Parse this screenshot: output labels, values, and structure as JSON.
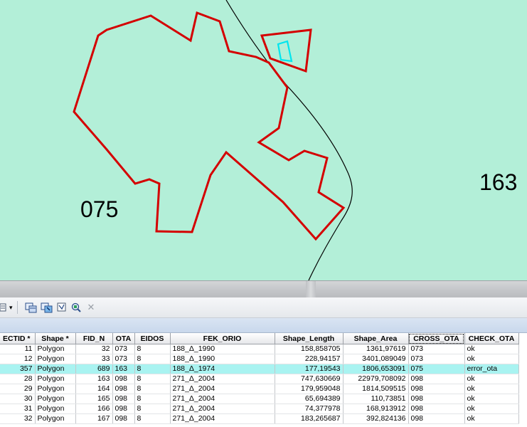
{
  "map": {
    "background_color": "#b3efd8",
    "polygon_outline_color": "#d40000",
    "selection_outline_color": "#00e5ee",
    "boundary_line_color": "#000000",
    "labels": [
      {
        "id": "zone-075",
        "text": "075"
      },
      {
        "id": "zone-163",
        "text": "163"
      }
    ]
  },
  "toolbar": {
    "buttons": [
      {
        "name": "table-options-icon",
        "label": "▾"
      },
      {
        "name": "related-tables-icon",
        "label": ""
      },
      {
        "name": "select-by-attributes-icon",
        "label": ""
      },
      {
        "name": "switch-selection-icon",
        "label": ""
      },
      {
        "name": "zoom-to-selected-icon",
        "label": ""
      },
      {
        "name": "delete-selected-icon",
        "label": "✕"
      }
    ]
  },
  "table": {
    "columns": [
      "ECTID *",
      "Shape *",
      "FID_N",
      "OTA",
      "EIDOS",
      "FEK_ORIO",
      "Shape_Length",
      "Shape_Area",
      "CROSS_OTA",
      "CHECK_OTA"
    ],
    "selected_column": "CROSS_OTA",
    "rows": [
      [
        "11",
        "Polygon",
        "32",
        "073",
        "8",
        "188_Δ_1990",
        "158,858705",
        "1361,97619",
        "073",
        "ok"
      ],
      [
        "12",
        "Polygon",
        "33",
        "073",
        "8",
        "188_Δ_1990",
        "228,94157",
        "3401,089049",
        "073",
        "ok"
      ],
      [
        "357",
        "Polygon",
        "689",
        "163",
        "8",
        "188_Δ_1974",
        "177,19543",
        "1806,653091",
        "075",
        "error_ota"
      ],
      [
        "28",
        "Polygon",
        "163",
        "098",
        "8",
        "271_Δ_2004",
        "747,630669",
        "22979,708092",
        "098",
        "ok"
      ],
      [
        "29",
        "Polygon",
        "164",
        "098",
        "8",
        "271_Δ_2004",
        "179,959048",
        "1814,509515",
        "098",
        "ok"
      ],
      [
        "30",
        "Polygon",
        "165",
        "098",
        "8",
        "271_Δ_2004",
        "65,694389",
        "110,73851",
        "098",
        "ok"
      ],
      [
        "31",
        "Polygon",
        "166",
        "098",
        "8",
        "271_Δ_2004",
        "74,377978",
        "168,913912",
        "098",
        "ok"
      ],
      [
        "32",
        "Polygon",
        "167",
        "098",
        "8",
        "271_Δ_2004",
        "183,265687",
        "392,824136",
        "098",
        "ok"
      ]
    ],
    "selected_row_index": 2
  }
}
